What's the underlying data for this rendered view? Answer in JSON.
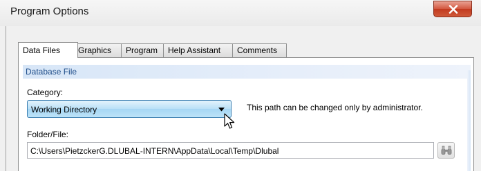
{
  "window": {
    "title": "Program Options"
  },
  "tabs": [
    {
      "label": "Data Files",
      "active": true
    },
    {
      "label": "Graphics",
      "active": false
    },
    {
      "label": "Program",
      "active": false
    },
    {
      "label": "Help Assistant",
      "active": false
    },
    {
      "label": "Comments",
      "active": false
    }
  ],
  "database_group": {
    "title": "Database File",
    "category_label": "Category:",
    "category_value": "Working Directory",
    "note": "This path can be changed only by administrator.",
    "folder_label": "Folder/File:",
    "folder_value": "C:\\Users\\PietzckerG.DLUBAL-INTERN\\AppData\\Local\\Temp\\Dlubal"
  },
  "icons": {
    "close": "close-icon",
    "dropdown": "chevron-down-icon",
    "browse": "binoculars-icon",
    "cursor": "mouse-pointer-icon"
  },
  "colors": {
    "close_button": "#c23a20",
    "group_header_text": "#1f4e8a",
    "combo_highlight": "#b9e0f7"
  }
}
